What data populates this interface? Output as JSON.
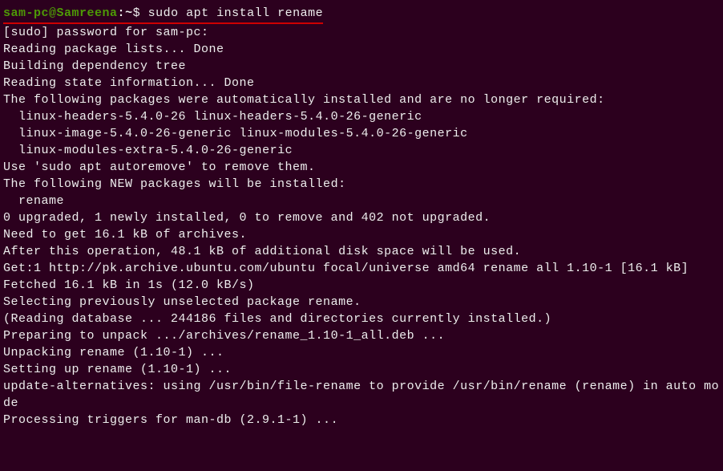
{
  "prompt": {
    "user": "sam-pc",
    "host": "Samreena",
    "path": "~",
    "dollar": "$"
  },
  "command": "sudo apt install rename",
  "output": [
    "[sudo] password for sam-pc:",
    "Reading package lists... Done",
    "Building dependency tree",
    "Reading state information... Done",
    "The following packages were automatically installed and are no longer required:",
    "  linux-headers-5.4.0-26 linux-headers-5.4.0-26-generic",
    "  linux-image-5.4.0-26-generic linux-modules-5.4.0-26-generic",
    "  linux-modules-extra-5.4.0-26-generic",
    "Use 'sudo apt autoremove' to remove them.",
    "The following NEW packages will be installed:",
    "  rename",
    "0 upgraded, 1 newly installed, 0 to remove and 402 not upgraded.",
    "Need to get 16.1 kB of archives.",
    "After this operation, 48.1 kB of additional disk space will be used.",
    "Get:1 http://pk.archive.ubuntu.com/ubuntu focal/universe amd64 rename all 1.10-1 [16.1 kB]",
    "Fetched 16.1 kB in 1s (12.0 kB/s)",
    "Selecting previously unselected package rename.",
    "(Reading database ... 244186 files and directories currently installed.)",
    "Preparing to unpack .../archives/rename_1.10-1_all.deb ...",
    "Unpacking rename (1.10-1) ...",
    "Setting up rename (1.10-1) ...",
    "update-alternatives: using /usr/bin/file-rename to provide /usr/bin/rename (rename) in auto mode",
    "Processing triggers for man-db (2.9.1-1) ..."
  ]
}
